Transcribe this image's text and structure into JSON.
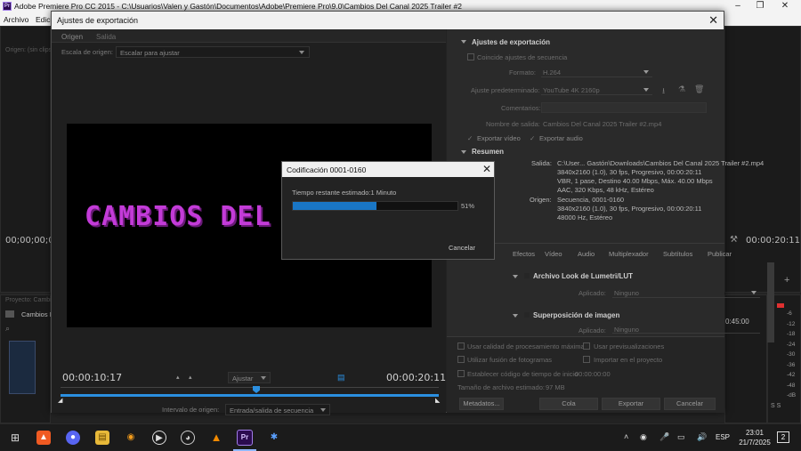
{
  "premiere": {
    "title": "Adobe Premiere Pro CC 2015 - C:\\Usuarios\\Valen y Gastón\\Documentos\\Adobe\\Premiere Pro\\9.0\\Cambios Del Canal 2025 Trailer #2",
    "logo_text": "Pr",
    "menu": [
      "Archivo",
      "Edici"
    ],
    "bg_timecode_left": "00;00;00;0",
    "bg_source_label": "Origen: (sin clips)",
    "bg_project_label": "Proyecto: Cambios",
    "bg_project_item": "Cambios D",
    "bg_timecode_right": "00:00:20:11",
    "bg_time_45": "0:45:00",
    "meter_labels": [
      "-6",
      "-12",
      "-18",
      "-24",
      "-30",
      "-36",
      "-42",
      "-48",
      "-dB"
    ],
    "meter_bottom": "S S"
  },
  "dialog": {
    "title": "Ajustes de exportación",
    "tabs": [
      "Origen",
      "Salida"
    ],
    "source_scaling_label": "Escala de origen:",
    "source_scaling_value": "Escalar para ajustar",
    "video_text": "CAMBIOS DEL C",
    "timecode_in": "00:00:10:17",
    "fit_label": "Ajustar",
    "timecode_out": "00:00:20:11",
    "range_label": "Intervalo de origen:",
    "range_value": "Entrada/salida de secuencia",
    "settings": {
      "section_title": "Ajustes de exportación",
      "match_sequence": "Coincide ajustes de secuencia",
      "format_label": "Formato:",
      "format_value": "H.264",
      "preset_label": "Ajuste predeterminado:",
      "preset_value": "YouTube 4K 2160p",
      "comments_label": "Comentarios:",
      "output_name_label": "Nombre de salida:",
      "output_name_value": "Cambios Del Canal 2025 Trailer #2.mp4",
      "export_video": "Exportar vídeo",
      "export_audio": "Exportar audio",
      "summary_title": "Resumen",
      "summary_output_label": "Salida:",
      "summary_output_lines": [
        "C:\\User... Gastón\\Downloads\\Cambios Del Canal 2025 Trailer #2.mp4",
        "3840x2160 (1.0), 30 fps, Progresivo, 00:00:20:11",
        "VBR, 1 pase, Destino 40.00 Mbps, Máx. 40.00 Mbps",
        "AAC, 320 Kbps, 48 kHz, Estéreo"
      ],
      "summary_source_label": "Origen:",
      "summary_source_lines": [
        "Secuencia, 0001-0160",
        "3840x2160 (1.0), 30 fps, Progresivo, 00:00:20:11",
        "48000 Hz, Estéreo"
      ],
      "tabs2": [
        "Efectos",
        "Vídeo",
        "Audio",
        "Multiplexador",
        "Subtítulos",
        "Publicar"
      ],
      "lumetri_title": "Archivo Look de Lumetri/LUT",
      "applied_label": "Aplicado:",
      "applied_value": "Ninguno",
      "overlay_title": "Superposición de imagen",
      "applied2_label": "Aplicado:",
      "applied2_value": "Ninguno",
      "max_quality": "Usar calidad de procesamiento máxima",
      "use_previews": "Usar previsualizaciones",
      "frame_blend": "Utilizar fusión de fotogramas",
      "import_project": "Importar en el proyecto",
      "set_start_tc": "Establecer código de tiempo de inicio",
      "start_tc_value": "00:00:00:00",
      "file_size_label": "Tamaño de archivo estimado:",
      "file_size_value": "97 MB",
      "metadata_button": "Metadatos...",
      "queue_button": "Cola",
      "export_button": "Exportar",
      "cancel_button": "Cancelar"
    }
  },
  "encoding": {
    "title": "Codificación 0001-0160",
    "remaining": "Tiempo restante estimado:1 Minuto",
    "percent_label": "51%",
    "progress": 0.51,
    "cancel_button": "Cancelar"
  },
  "taskbar": {
    "language": "ESP",
    "time": "23:01",
    "date": "21/7/2025",
    "notifications": "2",
    "pr_label": "Pr",
    "icons": [
      "windows-start-icon",
      "brave-icon",
      "discord-icon",
      "file-explorer-icon",
      "blender-icon",
      "media-player-icon",
      "obs-icon",
      "vlc-icon",
      "premiere-icon",
      "app-icon"
    ]
  },
  "colors": {
    "accent_blue": "#2b8fe0",
    "progress_blue": "#1976c5",
    "title_magenta": "#c33bd8"
  }
}
